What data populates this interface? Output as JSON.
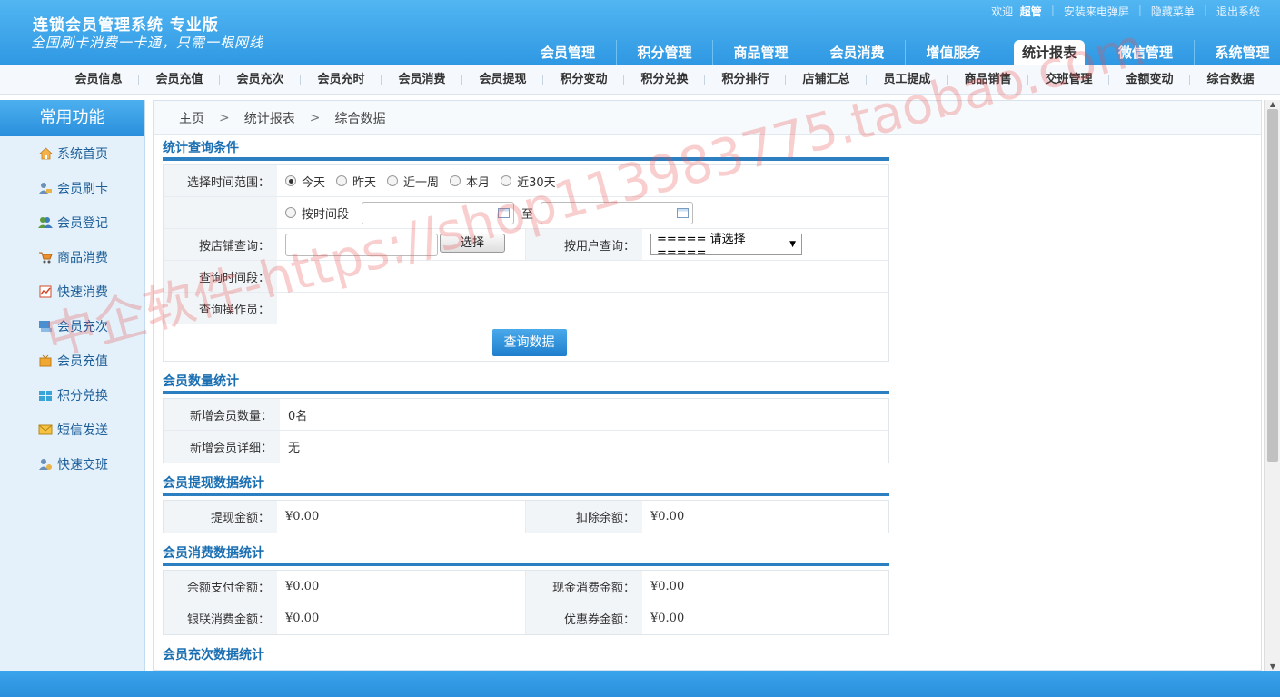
{
  "header": {
    "title": "连锁会员管理系统 专业版",
    "slogan": "全国刷卡消费一卡通，只需一根网线",
    "welcome": "欢迎",
    "user": "超管",
    "links": [
      "安装来电弹屏",
      "隐藏菜单",
      "退出系统"
    ]
  },
  "main_nav": [
    {
      "label": "会员管理",
      "active": false
    },
    {
      "label": "积分管理",
      "active": false
    },
    {
      "label": "商品管理",
      "active": false
    },
    {
      "label": "会员消费",
      "active": false
    },
    {
      "label": "增值服务",
      "active": false
    },
    {
      "label": "统计报表",
      "active": true
    },
    {
      "label": "微信管理",
      "active": false
    },
    {
      "label": "系统管理",
      "active": false
    }
  ],
  "sub_nav": [
    "会员信息",
    "会员充值",
    "会员充次",
    "会员充时",
    "会员消费",
    "会员提现",
    "积分变动",
    "积分兑换",
    "积分排行",
    "店铺汇总",
    "员工提成",
    "商品销售",
    "交班管理",
    "金额变动",
    "综合数据"
  ],
  "sidebar": {
    "title": "常用功能",
    "items": [
      {
        "label": "系统首页",
        "icon": "home-icon"
      },
      {
        "label": "会员刷卡",
        "icon": "member-card-icon"
      },
      {
        "label": "会员登记",
        "icon": "member-register-icon"
      },
      {
        "label": "商品消费",
        "icon": "cart-icon"
      },
      {
        "label": "快速消费",
        "icon": "chart-icon"
      },
      {
        "label": "会员充次",
        "icon": "recharge-count-icon"
      },
      {
        "label": "会员充值",
        "icon": "recharge-icon"
      },
      {
        "label": "积分兑换",
        "icon": "gift-icon"
      },
      {
        "label": "短信发送",
        "icon": "mail-icon"
      },
      {
        "label": "快速交班",
        "icon": "shift-icon"
      }
    ]
  },
  "breadcrumb": [
    "主页",
    "统计报表",
    "综合数据"
  ],
  "query": {
    "section_title": "统计查询条件",
    "time_range_label": "选择时间范围：",
    "time_options": [
      "今天",
      "昨天",
      "近一周",
      "本月",
      "近30天"
    ],
    "by_period_label": "按时间段",
    "to_label": "至",
    "store_label": "按店铺查询：",
    "select_button": "选择",
    "user_label": "按用户查询：",
    "user_select": "===== 请选择 =====",
    "period_label": "查询时间段：",
    "operator_label": "查询操作员：",
    "submit": "查询数据"
  },
  "member_count": {
    "section_title": "会员数量统计",
    "new_count_label": "新增会员数量：",
    "new_count_value": "0名",
    "new_detail_label": "新增会员详细：",
    "new_detail_value": "无"
  },
  "withdraw": {
    "section_title": "会员提现数据统计",
    "amount_label": "提现金额：",
    "amount_value": "¥0.00",
    "deduct_label": "扣除余额：",
    "deduct_value": "¥0.00"
  },
  "consume": {
    "section_title": "会员消费数据统计",
    "balance_label": "余额支付金额：",
    "balance_value": "¥0.00",
    "cash_label": "现金消费金额：",
    "cash_value": "¥0.00",
    "union_label": "银联消费金额：",
    "union_value": "¥0.00",
    "coupon_label": "优惠券金额：",
    "coupon_value": "¥0.00"
  },
  "recharge_count": {
    "section_title": "会员充次数据统计"
  },
  "watermark": "中企软件-https://shop113983775.taobao.com"
}
